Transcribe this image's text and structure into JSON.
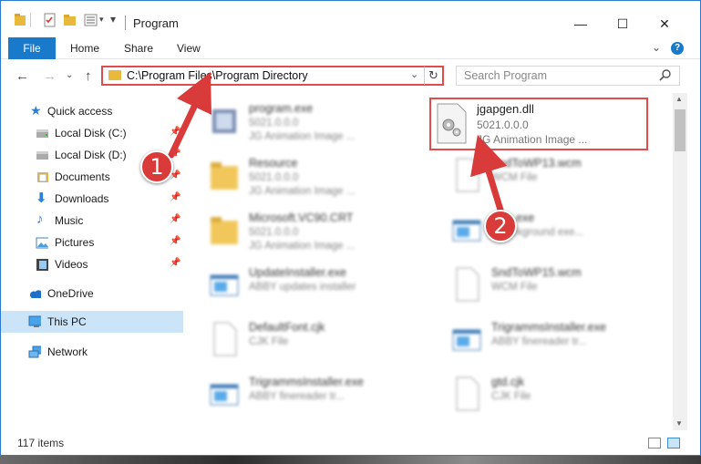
{
  "window": {
    "title": "Program"
  },
  "ribbon": {
    "tabs": [
      "File",
      "Home",
      "Share",
      "View"
    ]
  },
  "nav": {
    "address": "C:\\Program Files\\Program Directory",
    "search_placeholder": "Search Program"
  },
  "sidebar": {
    "items": [
      {
        "label": "Quick access",
        "icon": "star-icon",
        "pinned": false
      },
      {
        "label": "Local Disk (C:)",
        "icon": "drive-icon",
        "pinned": true
      },
      {
        "label": "Local Disk (D:)",
        "icon": "drive-icon",
        "pinned": true
      },
      {
        "label": "Documents",
        "icon": "documents-icon",
        "pinned": true
      },
      {
        "label": "Downloads",
        "icon": "download-icon",
        "pinned": true
      },
      {
        "label": "Music",
        "icon": "music-icon",
        "pinned": true
      },
      {
        "label": "Pictures",
        "icon": "pictures-icon",
        "pinned": true
      },
      {
        "label": "Videos",
        "icon": "videos-icon",
        "pinned": true
      },
      {
        "label": "OneDrive",
        "icon": "cloud-icon",
        "pinned": false
      },
      {
        "label": "This PC",
        "icon": "computer-icon",
        "pinned": false,
        "selected": true
      },
      {
        "label": "Network",
        "icon": "network-icon",
        "pinned": false
      }
    ]
  },
  "files": [
    {
      "name": "program.exe",
      "line1": "5021.0.0.0",
      "line2": "JG Animation Image ...",
      "icon": "exe-icon"
    },
    {
      "name": "jgapgen.dll",
      "line1": "5021.0.0.0",
      "line2": "JG Animation Image ...",
      "icon": "dll-gear-icon",
      "highlighted": true
    },
    {
      "name": "Resource",
      "line1": "5021.0.0.0",
      "line2": "JG Animation Image ...",
      "icon": "folder-icon"
    },
    {
      "name": "SndToWP13.wcm",
      "line1": "WCM File",
      "line2": "",
      "icon": "file-icon"
    },
    {
      "name": "Microsoft.VC90.CRT",
      "line1": "5021.0.0.0",
      "line2": "JG Animation Image ...",
      "icon": "folder-icon"
    },
    {
      "name": "...ec.exe",
      "line1": "...background exe...",
      "line2": "",
      "icon": "window-icon"
    },
    {
      "name": "UpdateInstaller.exe",
      "line1": "ABBY updates installer",
      "line2": "",
      "icon": "window-icon"
    },
    {
      "name": "SndToWP15.wcm",
      "line1": "WCM File",
      "line2": "",
      "icon": "file-icon"
    },
    {
      "name": "DefaultFont.cjk",
      "line1": "CJK File",
      "line2": "",
      "icon": "file-icon"
    },
    {
      "name": "TrigrammsInstaller.exe",
      "line1": "ABBY finereader tr...",
      "line2": "",
      "icon": "window-icon"
    },
    {
      "name": "TrigrammsInstaller.exe",
      "line1": "ABBY finereader tr...",
      "line2": "",
      "icon": "window-icon"
    },
    {
      "name": "gtd.cjk",
      "line1": "CJK File",
      "line2": "",
      "icon": "file-icon"
    }
  ],
  "status": {
    "items_count": "117 items"
  },
  "callouts": [
    "1",
    "2"
  ],
  "colors": {
    "accent": "#1979ca",
    "callout_red": "#d93a3a",
    "highlight_border": "#e04b4b",
    "selected_bg": "#cce4f7"
  }
}
